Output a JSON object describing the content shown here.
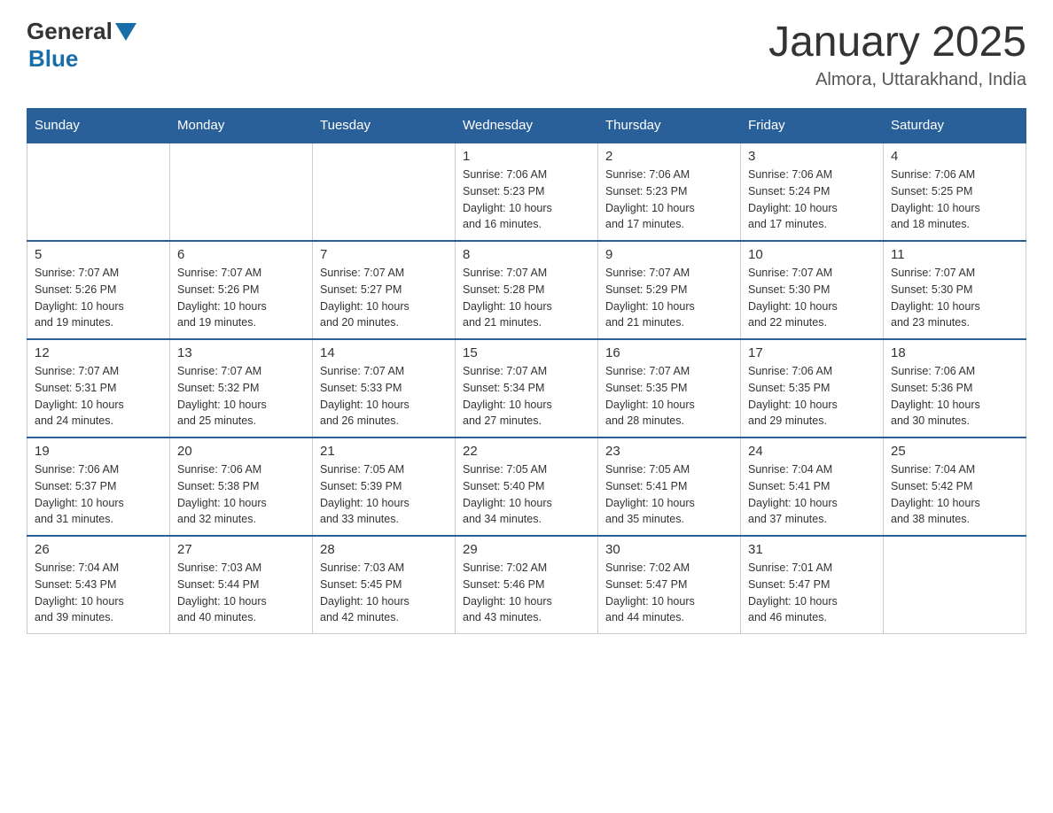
{
  "header": {
    "logo_general": "General",
    "logo_blue": "Blue",
    "month_title": "January 2025",
    "location": "Almora, Uttarakhand, India"
  },
  "days_of_week": [
    "Sunday",
    "Monday",
    "Tuesday",
    "Wednesday",
    "Thursday",
    "Friday",
    "Saturday"
  ],
  "weeks": [
    [
      {
        "day": "",
        "info": ""
      },
      {
        "day": "",
        "info": ""
      },
      {
        "day": "",
        "info": ""
      },
      {
        "day": "1",
        "info": "Sunrise: 7:06 AM\nSunset: 5:23 PM\nDaylight: 10 hours\nand 16 minutes."
      },
      {
        "day": "2",
        "info": "Sunrise: 7:06 AM\nSunset: 5:23 PM\nDaylight: 10 hours\nand 17 minutes."
      },
      {
        "day": "3",
        "info": "Sunrise: 7:06 AM\nSunset: 5:24 PM\nDaylight: 10 hours\nand 17 minutes."
      },
      {
        "day": "4",
        "info": "Sunrise: 7:06 AM\nSunset: 5:25 PM\nDaylight: 10 hours\nand 18 minutes."
      }
    ],
    [
      {
        "day": "5",
        "info": "Sunrise: 7:07 AM\nSunset: 5:26 PM\nDaylight: 10 hours\nand 19 minutes."
      },
      {
        "day": "6",
        "info": "Sunrise: 7:07 AM\nSunset: 5:26 PM\nDaylight: 10 hours\nand 19 minutes."
      },
      {
        "day": "7",
        "info": "Sunrise: 7:07 AM\nSunset: 5:27 PM\nDaylight: 10 hours\nand 20 minutes."
      },
      {
        "day": "8",
        "info": "Sunrise: 7:07 AM\nSunset: 5:28 PM\nDaylight: 10 hours\nand 21 minutes."
      },
      {
        "day": "9",
        "info": "Sunrise: 7:07 AM\nSunset: 5:29 PM\nDaylight: 10 hours\nand 21 minutes."
      },
      {
        "day": "10",
        "info": "Sunrise: 7:07 AM\nSunset: 5:30 PM\nDaylight: 10 hours\nand 22 minutes."
      },
      {
        "day": "11",
        "info": "Sunrise: 7:07 AM\nSunset: 5:30 PM\nDaylight: 10 hours\nand 23 minutes."
      }
    ],
    [
      {
        "day": "12",
        "info": "Sunrise: 7:07 AM\nSunset: 5:31 PM\nDaylight: 10 hours\nand 24 minutes."
      },
      {
        "day": "13",
        "info": "Sunrise: 7:07 AM\nSunset: 5:32 PM\nDaylight: 10 hours\nand 25 minutes."
      },
      {
        "day": "14",
        "info": "Sunrise: 7:07 AM\nSunset: 5:33 PM\nDaylight: 10 hours\nand 26 minutes."
      },
      {
        "day": "15",
        "info": "Sunrise: 7:07 AM\nSunset: 5:34 PM\nDaylight: 10 hours\nand 27 minutes."
      },
      {
        "day": "16",
        "info": "Sunrise: 7:07 AM\nSunset: 5:35 PM\nDaylight: 10 hours\nand 28 minutes."
      },
      {
        "day": "17",
        "info": "Sunrise: 7:06 AM\nSunset: 5:35 PM\nDaylight: 10 hours\nand 29 minutes."
      },
      {
        "day": "18",
        "info": "Sunrise: 7:06 AM\nSunset: 5:36 PM\nDaylight: 10 hours\nand 30 minutes."
      }
    ],
    [
      {
        "day": "19",
        "info": "Sunrise: 7:06 AM\nSunset: 5:37 PM\nDaylight: 10 hours\nand 31 minutes."
      },
      {
        "day": "20",
        "info": "Sunrise: 7:06 AM\nSunset: 5:38 PM\nDaylight: 10 hours\nand 32 minutes."
      },
      {
        "day": "21",
        "info": "Sunrise: 7:05 AM\nSunset: 5:39 PM\nDaylight: 10 hours\nand 33 minutes."
      },
      {
        "day": "22",
        "info": "Sunrise: 7:05 AM\nSunset: 5:40 PM\nDaylight: 10 hours\nand 34 minutes."
      },
      {
        "day": "23",
        "info": "Sunrise: 7:05 AM\nSunset: 5:41 PM\nDaylight: 10 hours\nand 35 minutes."
      },
      {
        "day": "24",
        "info": "Sunrise: 7:04 AM\nSunset: 5:41 PM\nDaylight: 10 hours\nand 37 minutes."
      },
      {
        "day": "25",
        "info": "Sunrise: 7:04 AM\nSunset: 5:42 PM\nDaylight: 10 hours\nand 38 minutes."
      }
    ],
    [
      {
        "day": "26",
        "info": "Sunrise: 7:04 AM\nSunset: 5:43 PM\nDaylight: 10 hours\nand 39 minutes."
      },
      {
        "day": "27",
        "info": "Sunrise: 7:03 AM\nSunset: 5:44 PM\nDaylight: 10 hours\nand 40 minutes."
      },
      {
        "day": "28",
        "info": "Sunrise: 7:03 AM\nSunset: 5:45 PM\nDaylight: 10 hours\nand 42 minutes."
      },
      {
        "day": "29",
        "info": "Sunrise: 7:02 AM\nSunset: 5:46 PM\nDaylight: 10 hours\nand 43 minutes."
      },
      {
        "day": "30",
        "info": "Sunrise: 7:02 AM\nSunset: 5:47 PM\nDaylight: 10 hours\nand 44 minutes."
      },
      {
        "day": "31",
        "info": "Sunrise: 7:01 AM\nSunset: 5:47 PM\nDaylight: 10 hours\nand 46 minutes."
      },
      {
        "day": "",
        "info": ""
      }
    ]
  ]
}
